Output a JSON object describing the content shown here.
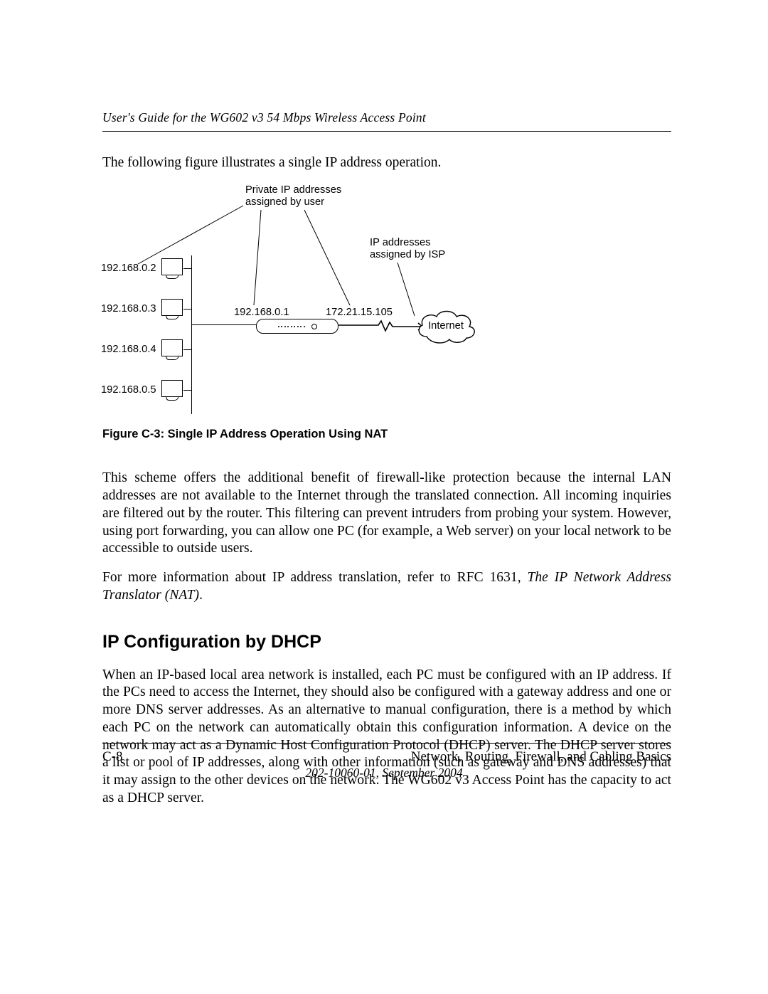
{
  "header": {
    "title": "User's Guide for the WG602 v3 54 Mbps Wireless Access Point"
  },
  "lead": "The following figure illustrates a single IP address operation.",
  "diagram": {
    "private_label_l1": "Private IP addresses",
    "private_label_l2": "assigned by user",
    "isp_label_l1": "IP addresses",
    "isp_label_l2": "assigned by ISP",
    "ips": [
      "192.168.0.2",
      "192.168.0.3",
      "192.168.0.4",
      "192.168.0.5"
    ],
    "router_lan_ip": "192.168.0.1",
    "router_wan_ip": "172.21.15.105",
    "cloud_label": "Internet"
  },
  "figure_caption": "Figure C-3:  Single IP Address Operation Using NAT",
  "para1": "This scheme offers the additional benefit of firewall-like protection because the internal LAN addresses are not available to the Internet through the translated connection. All incoming inquiries are filtered out by the router. This filtering can prevent intruders from probing your system. However, using port forwarding, you can allow one PC (for example, a Web server) on your local network to be accessible to outside users.",
  "para2_a": "For more information about IP address translation, refer to RFC 1631, ",
  "para2_b_italic": "The IP Network Address Translator (NAT)",
  "para2_c": ".",
  "section_heading": "IP Configuration by DHCP",
  "para3": "When an IP-based local area network is installed, each PC must be configured with an IP address. If the PCs need to access the Internet, they should also be configured with a gateway address and one or more DNS server addresses. As an alternative to manual configuration, there is a method by which each PC on the network can automatically obtain this configuration information. A device on the network may act as a Dynamic Host Configuration Protocol (DHCP) server. The DHCP server stores a list or pool of IP addresses, along with other information (such as gateway and DNS addresses) that it may assign to the other devices on the network. The WG602 v3 Access Point has the capacity to act as a DHCP server.",
  "footer": {
    "page_number": "C-8",
    "section": "Network, Routing, Firewall, and Cabling Basics",
    "publication": "202-10060-01, September 2004"
  }
}
